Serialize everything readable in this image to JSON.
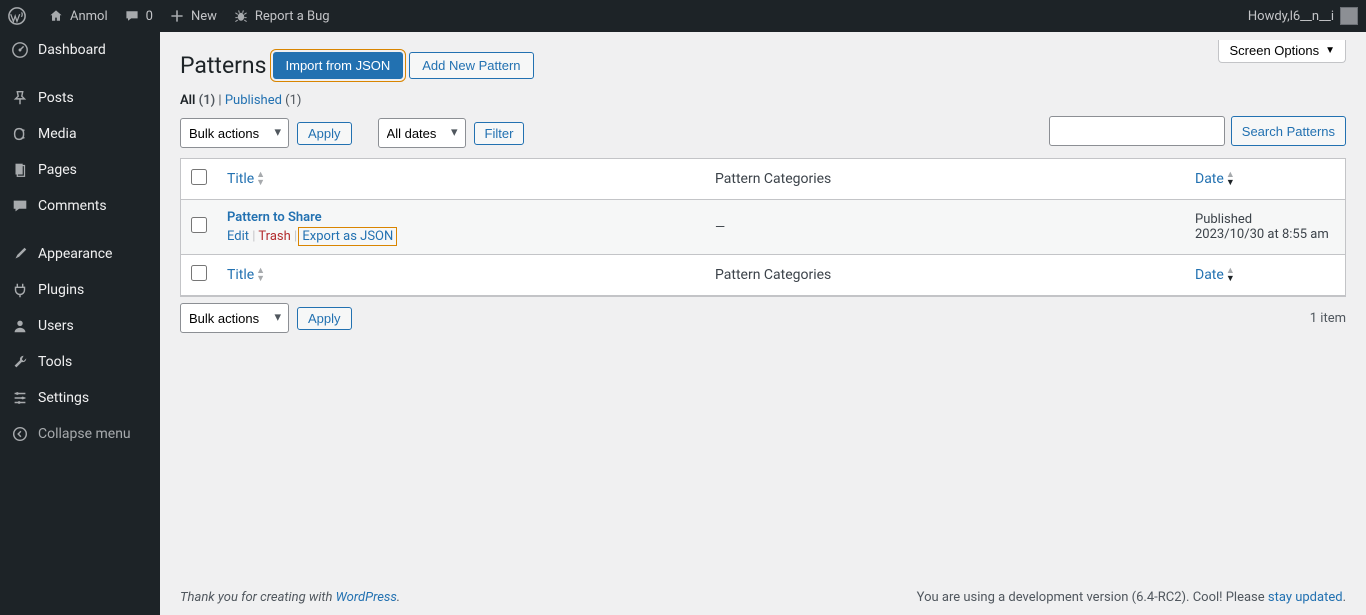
{
  "adminbar": {
    "site_name": "Anmol",
    "comments_count": "0",
    "new_label": "New",
    "bug_label": "Report a Bug",
    "howdy_prefix": "Howdy, ",
    "username": "l6__n__i"
  },
  "sidebar": {
    "items": [
      {
        "label": "Dashboard"
      },
      {
        "label": "Posts"
      },
      {
        "label": "Media"
      },
      {
        "label": "Pages"
      },
      {
        "label": "Comments"
      },
      {
        "label": "Appearance"
      },
      {
        "label": "Plugins"
      },
      {
        "label": "Users"
      },
      {
        "label": "Tools"
      },
      {
        "label": "Settings"
      }
    ],
    "collapse_label": "Collapse menu"
  },
  "screen_options_label": "Screen Options",
  "page_title": "Patterns",
  "buttons": {
    "import": "Import from JSON",
    "add_new": "Add New Pattern",
    "apply": "Apply",
    "filter": "Filter",
    "search": "Search Patterns"
  },
  "subsub": {
    "all_label": "All",
    "all_count": "(1)",
    "sep": " | ",
    "published_label": "Published",
    "published_count": "(1)"
  },
  "bulk_action_selected": "Bulk actions",
  "date_filter_selected": "All dates",
  "item_count": "1 item",
  "columns": {
    "title": "Title",
    "categories": "Pattern Categories",
    "date": "Date"
  },
  "rows": [
    {
      "title": "Pattern to Share",
      "categories": "—",
      "status": "Published",
      "datetime": "2023/10/30 at 8:55 am",
      "actions": {
        "edit": "Edit",
        "trash": "Trash",
        "export": "Export as JSON"
      }
    }
  ],
  "footer": {
    "thank_prefix": "Thank you for creating with ",
    "wp_link": "WordPress",
    "thank_suffix": ".",
    "right_prefix": "You are using a development version (6.4-RC2). Cool! Please ",
    "stay_updated": "stay updated",
    "right_suffix": "."
  }
}
